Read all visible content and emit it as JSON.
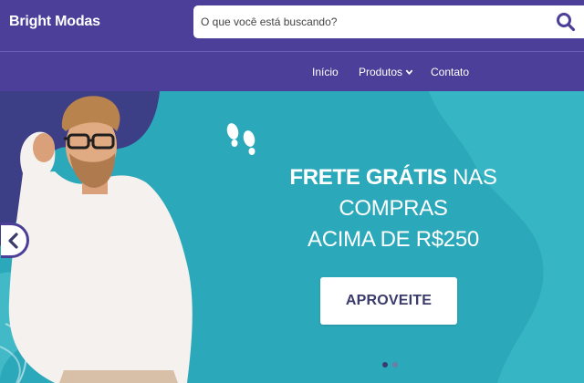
{
  "header": {
    "brand": "Bright Modas",
    "search": {
      "placeholder": "O que você está buscando?",
      "value": "",
      "icon": "search-icon"
    }
  },
  "nav": {
    "items": [
      {
        "label": "Início"
      },
      {
        "label": "Produtos",
        "icon": "chevron-down-icon"
      },
      {
        "label": "Contato"
      }
    ]
  },
  "banner": {
    "headline_bold": "FRETE GRÁTIS",
    "headline_rest": " NAS COMPRAS",
    "headline_line2": "ACIMA DE R$250",
    "cta_label": "APROVEITE",
    "slides_total": 2,
    "active_slide": 1
  },
  "colors": {
    "header_bg": "#4b3f99",
    "banner_bg": "#2ba8b9",
    "cta_text": "#3b3b6b"
  }
}
